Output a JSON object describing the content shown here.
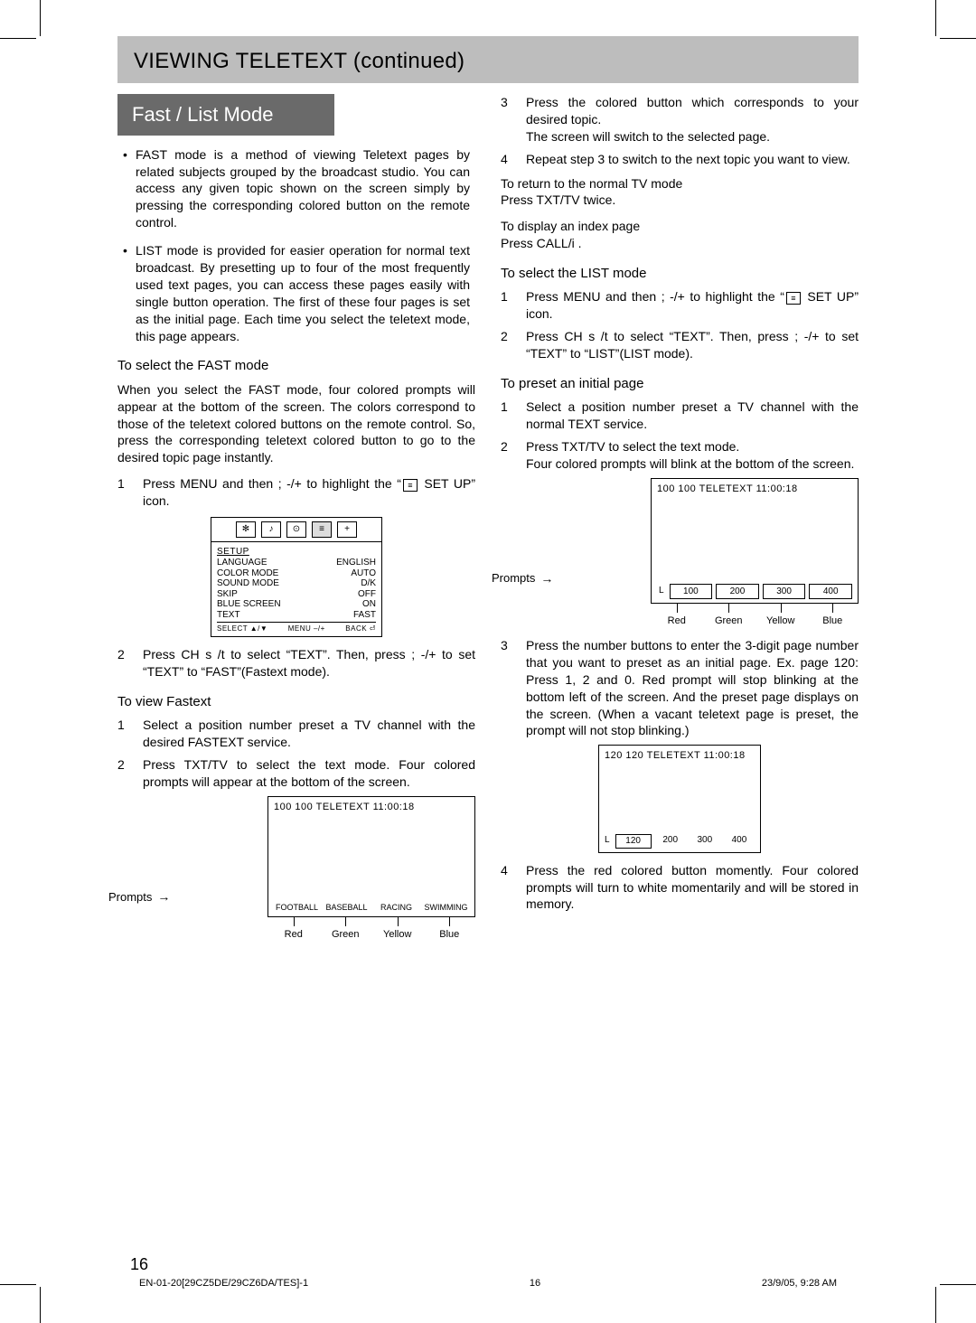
{
  "header": {
    "title": "VIEWING TELETEXT (continued)"
  },
  "mode_header": "Fast / List Mode",
  "bullets": [
    "FAST mode is a method of viewing Teletext pages by related subjects grouped by the broadcast studio. You can access any given topic shown on the screen simply by pressing the corresponding colored button on the remote control.",
    "LIST mode  is provided for easier operation for normal text broadcast. By presetting up to four of the most frequently used text pages, you can access these pages easily with single button operation. The first of these four pages is set as the initial page. Each time you select the teletext mode, this page appears."
  ],
  "fast": {
    "subhdr": "To select the FAST mode",
    "intro": "When you select the FAST mode, four colored prompts will appear at the bottom of the screen. The colors correspond to those of the teletext colored buttons on the remote control. So, press the corresponding teletext colored button to go to the desired topic page instantly.",
    "s1_pre": "Press MENU and then ;    -/+ to highlight the “",
    "s1_post": " SET UP” icon.",
    "s2": "Press CH s /t  to select “TEXT”. Then, press ;   -/+ to set “TEXT” to “FAST”(Fastext mode)."
  },
  "osd": {
    "title": "SETUP",
    "rows": [
      {
        "l": "LANGUAGE",
        "r": "ENGLISH"
      },
      {
        "l": "COLOR MODE",
        "r": "AUTO"
      },
      {
        "l": "SOUND MODE",
        "r": "D/K"
      },
      {
        "l": "SKIP",
        "r": "OFF"
      },
      {
        "l": "BLUE SCREEN",
        "r": "ON"
      },
      {
        "l": "TEXT",
        "r": "FAST"
      }
    ],
    "foot": {
      "l": "SELECT ▲/▼",
      "m": "MENU –/+",
      "r": "BACK ⏎"
    }
  },
  "view_fastext": {
    "subhdr": "To view Fastext",
    "s1": "Select a position number preset a TV channel with the desired FASTEXT service.",
    "s2": "Press TXT/TV to select the text mode. Four colored prompts will appear at the bottom of the screen."
  },
  "ttx1": {
    "head": "100 100   TELETEXT   11:00:18",
    "prompts": [
      "FOOTBALL",
      "BASEBALL",
      "RACING",
      "SWIMMING"
    ],
    "label": "Prompts",
    "colors": {
      "r": "Red",
      "g": "Green",
      "y": "Yellow",
      "b": "Blue"
    }
  },
  "right": {
    "s3": "Press the colored button which corresponds to your desired topic.",
    "s3b": "The screen will switch to the selected page.",
    "s4": "Repeat step 3 to switch to the next topic you want to view.",
    "ret1": "To return to the normal TV mode",
    "ret2": "Press TXT/TV twice.",
    "idx1": "To display an index page",
    "idx2": "Press CALL/i   ."
  },
  "list": {
    "subhdr": "To select the LIST mode",
    "s1_pre": "Press MENU and then ;   -/+ to highlight the “",
    "s1_post": " SET UP” icon.",
    "s2": "Press CH s /t  to select “TEXT”. Then, press ;   -/+ to set “TEXT” to “LIST”(LIST mode)."
  },
  "preset": {
    "subhdr": "To preset an initial page",
    "s1": "Select a position number preset a TV channel with the normal TEXT service.",
    "s2": "Press TXT/TV to select the text mode.",
    "s2b": "Four colored prompts will blink at the bottom of the screen."
  },
  "ttx2": {
    "head": "100 100   TELETEXT   11:00:18",
    "l": "L",
    "prompts": [
      "100",
      "200",
      "300",
      "400"
    ],
    "label": "Prompts",
    "colors": {
      "r": "Red",
      "g": "Green",
      "y": "Yellow",
      "b": "Blue"
    }
  },
  "preset2": {
    "s3": "Press the number buttons to enter the 3-digit page number that you want to preset as an initial page. Ex. page 120:  Press 1, 2 and 0. Red prompt will stop blinking at the bottom left of the screen. And the preset page displays on the screen. (When a vacant teletext page is preset, the prompt will not stop blinking.)"
  },
  "ttx3": {
    "head": "120 120   TELETEXT   11:00:18",
    "l": "L",
    "prompts": [
      "120",
      "200",
      "300",
      "400"
    ]
  },
  "preset3": {
    "s4": "Press the red colored button momently. Four colored prompts will turn to white momentarily and will be stored in memory."
  },
  "page_number": "16",
  "footer": {
    "l": "EN-01-20[29CZ5DE/29CZ6DA/TES]-1",
    "m": "16",
    "r": "23/9/05, 9:28 AM"
  }
}
